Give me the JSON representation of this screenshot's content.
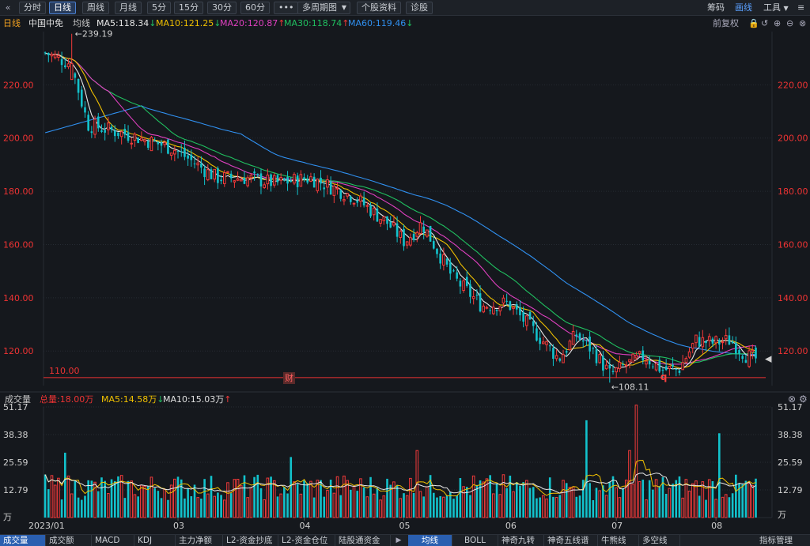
{
  "toolbar": {
    "back_icon": "chevron-left-icon",
    "buttons": [
      {
        "label": "分时"
      },
      {
        "label": "日线"
      },
      {
        "label": "周线"
      },
      {
        "label": "月线"
      },
      {
        "label": "5分"
      },
      {
        "label": "15分"
      },
      {
        "label": "30分"
      },
      {
        "label": "60分"
      },
      {
        "label": "•••"
      },
      {
        "label": "多周期图"
      },
      {
        "label": "个股资料"
      },
      {
        "label": "诊股"
      }
    ],
    "multi_dropdown_icon": "caret-down-icon",
    "right": [
      {
        "label": "筹码"
      },
      {
        "label": "画线"
      },
      {
        "label": "工具"
      }
    ],
    "more_icon": "menu-icon"
  },
  "legend": {
    "period": "日线",
    "name": "中国中免",
    "avg": "均线",
    "ma5": "MA5:118.34",
    "ma10": "MA10:121.25",
    "ma20": "MA20:120.87",
    "ma30": "MA30:118.74",
    "ma60": "MA60:119.46",
    "adjust": "前复权"
  },
  "colors": {
    "up": "#f23a3a",
    "down": "#12c2cc",
    "ma5": "#e8e8e8",
    "ma10": "#f0c000",
    "ma20": "#e040c0",
    "ma30": "#20c060",
    "ma60": "#3090f0",
    "axis_text": "#ee3333",
    "grid": "#262b33"
  },
  "annotations": {
    "high_label": "239.19",
    "low_label": "108.11",
    "level_label": "110.00",
    "marker_cai": "财",
    "marker_q": "q"
  },
  "volume_legend": {
    "title": "成交量",
    "total": "总量:18.00万",
    "ma5": "MA5:14.58万",
    "ma10": "MA10:15.03万"
  },
  "tabs": [
    {
      "label": "成交量"
    },
    {
      "label": "成交额"
    },
    {
      "label": "MACD"
    },
    {
      "label": "KDJ"
    },
    {
      "label": "主力净额"
    },
    {
      "label": "L2-资金抄底"
    },
    {
      "label": "L2-资金仓位"
    },
    {
      "label": "陆股通资金"
    },
    {
      "label": "均线"
    },
    {
      "label": "BOLL"
    },
    {
      "label": "神奇九转"
    },
    {
      "label": "神奇五线谱"
    },
    {
      "label": "牛熊线"
    },
    {
      "label": "多空线"
    },
    {
      "label": "指标管理"
    }
  ],
  "chart_data": [
    {
      "type": "candlestick",
      "title": "中国中免 日线",
      "y_ticks": [
        "220.00",
        "200.00",
        "180.00",
        "160.00",
        "140.00",
        "120.00"
      ],
      "y_tick_values": [
        220,
        200,
        180,
        160,
        140,
        120
      ],
      "ylim": [
        107,
        240
      ],
      "x_range": [
        "2023-01-03",
        "2023-08-22"
      ],
      "reference_level": 110.0,
      "candle_count": 150,
      "key_points": [
        {
          "index": 0,
          "close": 232
        },
        {
          "index": 6,
          "close": 228,
          "high": 239.19
        },
        {
          "index": 10,
          "close": 205
        },
        {
          "index": 20,
          "close": 201
        },
        {
          "index": 30,
          "close": 196
        },
        {
          "index": 40,
          "close": 185
        },
        {
          "index": 47,
          "close": 185
        },
        {
          "index": 54,
          "close": 183
        },
        {
          "index": 62,
          "close": 185
        },
        {
          "index": 72,
          "close": 178
        },
        {
          "index": 80,
          "close": 168
        },
        {
          "index": 84,
          "close": 161
        },
        {
          "index": 88,
          "close": 168
        },
        {
          "index": 95,
          "close": 148
        },
        {
          "index": 102,
          "close": 137
        },
        {
          "index": 108,
          "close": 138
        },
        {
          "index": 115,
          "close": 126
        },
        {
          "index": 120,
          "close": 117
        },
        {
          "index": 124,
          "close": 126
        },
        {
          "index": 128,
          "close": 120
        },
        {
          "index": 132,
          "close": 111,
          "low": 108.11
        },
        {
          "index": 136,
          "close": 115
        },
        {
          "index": 140,
          "close": 118
        },
        {
          "index": 144,
          "close": 113
        },
        {
          "index": 148,
          "close": 113
        },
        {
          "index": 152,
          "close": 124
        },
        {
          "index": 156,
          "close": 123
        },
        {
          "index": 160,
          "close": 124
        },
        {
          "index": 164,
          "close": 118
        },
        {
          "index": 166,
          "close": 117
        }
      ],
      "series": [
        {
          "name": "MA5",
          "values_at_end": 118.34
        },
        {
          "name": "MA10",
          "values_at_end": 121.25
        },
        {
          "name": "MA20",
          "values_at_end": 120.87
        },
        {
          "name": "MA30",
          "values_at_end": 118.74
        },
        {
          "name": "MA60",
          "values_at_end": 119.46
        }
      ]
    },
    {
      "type": "bar",
      "title": "成交量",
      "y_ticks": [
        "51.17",
        "38.38",
        "25.59",
        "12.79"
      ],
      "y_tick_values": [
        51.17,
        38.38,
        25.59,
        12.79
      ],
      "y_unit": "万",
      "ylim": [
        0,
        51.17
      ],
      "x_labels": [
        "2023/01",
        "03",
        "04",
        "05",
        "06",
        "07",
        "08"
      ],
      "x_label_index": [
        0,
        40,
        78,
        108,
        140,
        172,
        202
      ],
      "key_volumes": [
        {
          "index": 6,
          "value": 30
        },
        {
          "index": 74,
          "value": 28
        },
        {
          "index": 112,
          "value": 31
        },
        {
          "index": 163,
          "value": 45
        },
        {
          "index": 178,
          "value": 52
        },
        {
          "index": 176,
          "value": 31
        },
        {
          "index": 203,
          "value": 39
        },
        {
          "index": 214,
          "value": 18
        }
      ]
    }
  ]
}
